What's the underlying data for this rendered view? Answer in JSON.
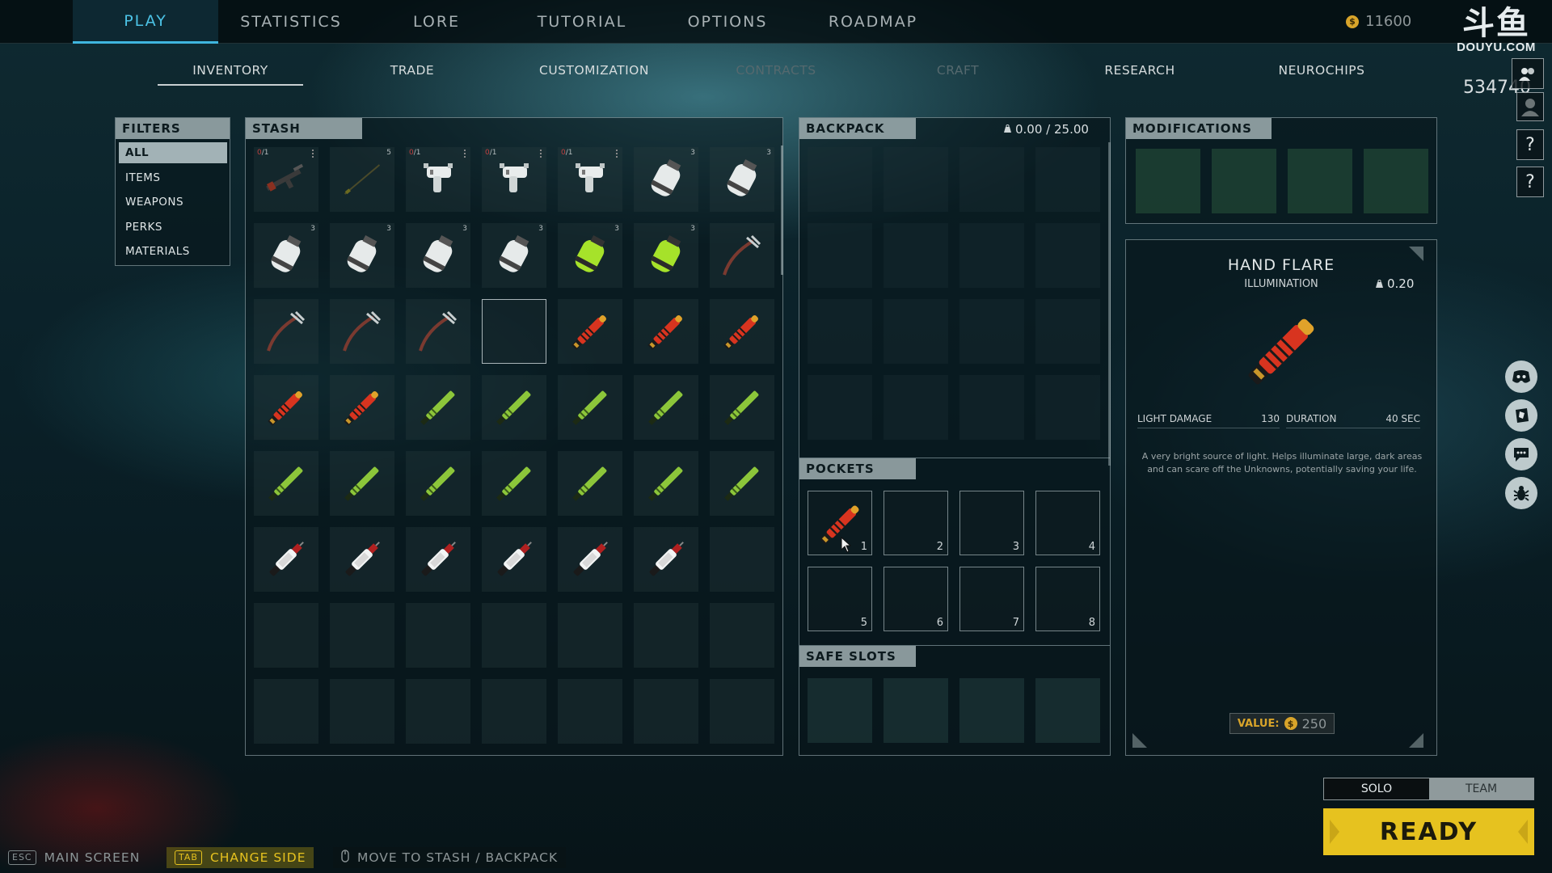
{
  "top_nav": {
    "tabs": [
      {
        "label": "PLAY",
        "active": true
      },
      {
        "label": "STATISTICS"
      },
      {
        "label": "LORE"
      },
      {
        "label": "TUTORIAL"
      },
      {
        "label": "OPTIONS"
      },
      {
        "label": "ROADMAP"
      }
    ],
    "credits": "11600",
    "coin_symbol": "$"
  },
  "stream_overlay": {
    "logo_big": "斗鱼",
    "logo_small": "DOUYU.COM",
    "room_id": "534740"
  },
  "sub_nav": {
    "tabs": [
      {
        "label": "INVENTORY",
        "state": "active"
      },
      {
        "label": "TRADE",
        "state": "normal"
      },
      {
        "label": "CUSTOMIZATION",
        "state": "normal"
      },
      {
        "label": "CONTRACTS",
        "state": "disabled"
      },
      {
        "label": "CRAFT",
        "state": "disabled"
      },
      {
        "label": "RESEARCH",
        "state": "normal"
      },
      {
        "label": "NEUROCHIPS",
        "state": "normal"
      }
    ]
  },
  "filters": {
    "title": "FILTERS",
    "items": [
      {
        "label": "ALL",
        "active": true
      },
      {
        "label": "ITEMS"
      },
      {
        "label": "WEAPONS"
      },
      {
        "label": "PERKS"
      },
      {
        "label": "MATERIALS"
      }
    ]
  },
  "stash": {
    "title": "STASH",
    "rows": [
      [
        {
          "item": "rifle",
          "durability": "0",
          "durability_max": "/1",
          "menu": true
        },
        {
          "item": "rod",
          "count": "5"
        },
        {
          "item": "pistol",
          "durability": "0",
          "durability_max": "/1",
          "menu": true
        },
        {
          "item": "pistol",
          "durability": "0",
          "durability_max": "/1",
          "menu": true
        },
        {
          "item": "pistol",
          "durability": "0",
          "durability_max": "/1",
          "menu": true
        },
        {
          "item": "canister",
          "count": "3"
        },
        {
          "item": "canister",
          "count": "3"
        }
      ],
      [
        {
          "item": "canister",
          "count": "3"
        },
        {
          "item": "canister",
          "count": "3"
        },
        {
          "item": "canister",
          "count": "3"
        },
        {
          "item": "canister",
          "count": "3"
        },
        {
          "item": "canister-green",
          "count": "3"
        },
        {
          "item": "canister-green",
          "count": "3"
        },
        {
          "item": "pickaxe"
        }
      ],
      [
        {
          "item": "pickaxe"
        },
        {
          "item": "pickaxe"
        },
        {
          "item": "pickaxe"
        },
        {
          "item": "empty",
          "selected": true
        },
        {
          "item": "flare-red"
        },
        {
          "item": "flare-red"
        },
        {
          "item": "flare-red"
        }
      ],
      [
        {
          "item": "flare-red"
        },
        {
          "item": "flare-red"
        },
        {
          "item": "glowstick"
        },
        {
          "item": "glowstick"
        },
        {
          "item": "glowstick"
        },
        {
          "item": "glowstick"
        },
        {
          "item": "glowstick"
        }
      ],
      [
        {
          "item": "glowstick"
        },
        {
          "item": "glowstick"
        },
        {
          "item": "glowstick"
        },
        {
          "item": "glowstick"
        },
        {
          "item": "glowstick"
        },
        {
          "item": "glowstick"
        },
        {
          "item": "glowstick"
        }
      ],
      [
        {
          "item": "syringe"
        },
        {
          "item": "syringe"
        },
        {
          "item": "syringe"
        },
        {
          "item": "syringe"
        },
        {
          "item": "syringe"
        },
        {
          "item": "syringe"
        },
        {
          "item": "empty"
        }
      ],
      [
        {
          "item": "empty"
        },
        {
          "item": "empty"
        },
        {
          "item": "empty"
        },
        {
          "item": "empty"
        },
        {
          "item": "empty"
        },
        {
          "item": "empty"
        },
        {
          "item": "empty"
        }
      ],
      [
        {
          "item": "empty"
        },
        {
          "item": "empty"
        },
        {
          "item": "empty"
        },
        {
          "item": "empty"
        },
        {
          "item": "empty"
        },
        {
          "item": "empty"
        },
        {
          "item": "empty"
        }
      ]
    ]
  },
  "backpack": {
    "title": "BACKPACK",
    "weight": "0.00 / 25.00"
  },
  "pockets": {
    "title": "POCKETS",
    "slots": [
      {
        "num": "1",
        "item": "flare-red"
      },
      {
        "num": "2"
      },
      {
        "num": "3"
      },
      {
        "num": "4"
      },
      {
        "num": "5"
      },
      {
        "num": "6"
      },
      {
        "num": "7"
      },
      {
        "num": "8"
      }
    ]
  },
  "safe_slots": {
    "title": "SAFE SLOTS"
  },
  "modifications": {
    "title": "MODIFICATIONS"
  },
  "detail": {
    "name": "HAND FLARE",
    "category": "ILLUMINATION",
    "weight": "0.20",
    "stats": [
      {
        "label": "LIGHT DAMAGE",
        "value": "130"
      },
      {
        "label": "DURATION",
        "value": "40 SEC"
      }
    ],
    "description": "A very bright source of light. Helps illuminate large, dark areas and can scare off the Unknowns, potentially saving your life.",
    "value_label": "VALUE:",
    "value": "250"
  },
  "mode": {
    "solo": "SOLO",
    "team": "TEAM",
    "selected": "SOLO"
  },
  "ready_label": "READY",
  "side_buttons": {
    "help": "?"
  },
  "footer_hints": [
    {
      "key": "ESC",
      "label": "MAIN SCREEN"
    },
    {
      "key": "TAB",
      "label": "CHANGE SIDE",
      "highlight": true
    },
    {
      "key": "mouse",
      "label": "MOVE TO STASH / BACKPACK"
    }
  ],
  "colors": {
    "accent_cyan": "#3fb6de",
    "ready_yellow": "#e6c21f",
    "flare_red": "#d8341f",
    "glow_green": "#8cc63a"
  }
}
